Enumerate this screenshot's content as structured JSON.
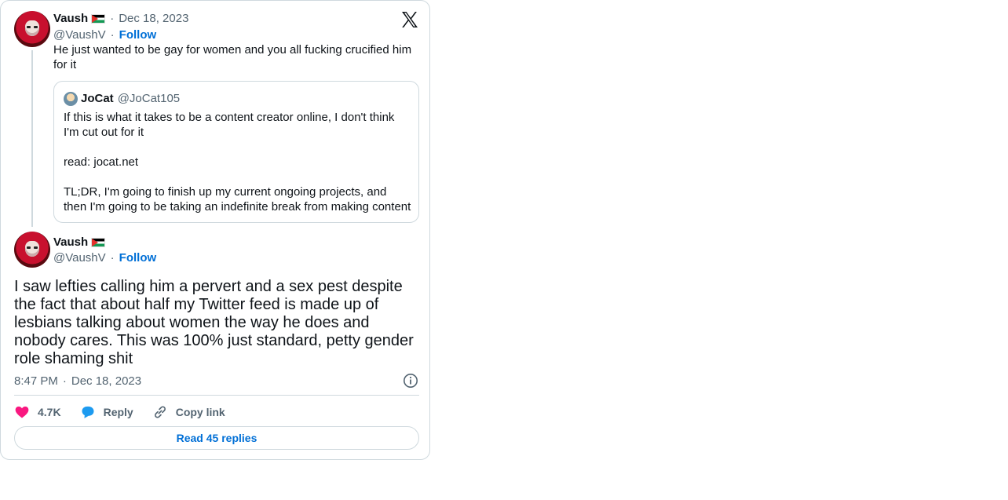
{
  "parent_tweet": {
    "author_name": "Vaush",
    "handle": "@VaushV",
    "date": "Dec 18, 2023",
    "follow_label": "Follow",
    "text": "He just wanted to be gay for women and you all fucking crucified him for it"
  },
  "quoted_tweet": {
    "author_name": "JoCat",
    "handle": "@JoCat105",
    "text": "If this is what it takes to be a content creator online, I don't think I'm cut out for it\n\nread: jocat.net\n\nTL;DR, I'm going to finish up my current ongoing projects, and then I'm going to be taking an indefinite break from making content"
  },
  "main_tweet": {
    "author_name": "Vaush",
    "handle": "@VaushV",
    "follow_label": "Follow",
    "text": "I saw lefties calling him a pervert and a sex pest despite the fact that about half my Twitter feed is made up of lesbians talking about women the way he does and nobody cares. This was 100% just standard, petty gender role shaming shit",
    "time": "8:47 PM",
    "date": "Dec 18, 2023"
  },
  "actions": {
    "like_count": "4.7K",
    "reply_label": "Reply",
    "copy_label": "Copy link",
    "read_replies_label": "Read 45 replies"
  },
  "separator": "·",
  "colors": {
    "like": "#f91880",
    "reply": "#1d9bf0",
    "link": "#006fd6",
    "muted": "#536471",
    "border": "#cfd9de"
  },
  "icons": [
    "x-logo-icon",
    "flag-icon",
    "heart-icon",
    "reply-bubble-icon",
    "link-icon",
    "info-icon"
  ]
}
